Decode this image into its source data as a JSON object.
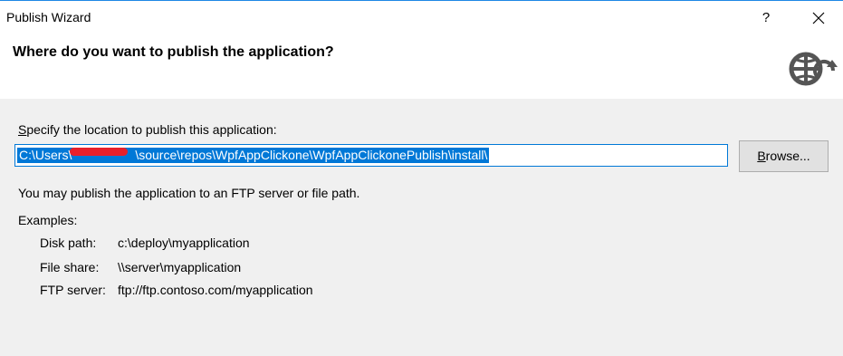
{
  "window": {
    "title": "Publish Wizard",
    "help_glyph": "?",
    "close_icon": "close-icon"
  },
  "header": {
    "title": "Where do you want to publish the application?",
    "icon": "globe-publish-icon"
  },
  "location": {
    "label_access_key": "S",
    "label_rest": "pecify the location to publish this application:",
    "path_value": "C:\\Users\\     \\source\\repos\\WpfAppClickone\\WpfAppClickonePublish\\install\\",
    "browse_access_key": "B",
    "browse_rest": "rowse..."
  },
  "info": {
    "description": "You may publish the application to an FTP server or file path.",
    "examples_label": "Examples:",
    "examples": [
      {
        "label": "Disk path:",
        "value": "c:\\deploy\\myapplication"
      },
      {
        "label": "File share:",
        "value": "\\\\server\\myapplication"
      },
      {
        "label": "FTP server:",
        "value": "ftp://ftp.contoso.com/myapplication"
      }
    ]
  },
  "colors": {
    "accent": "#0078d7",
    "redaction": "#e8202a",
    "panel_bg": "#f0f0f0",
    "header_bg": "#ffffff"
  }
}
